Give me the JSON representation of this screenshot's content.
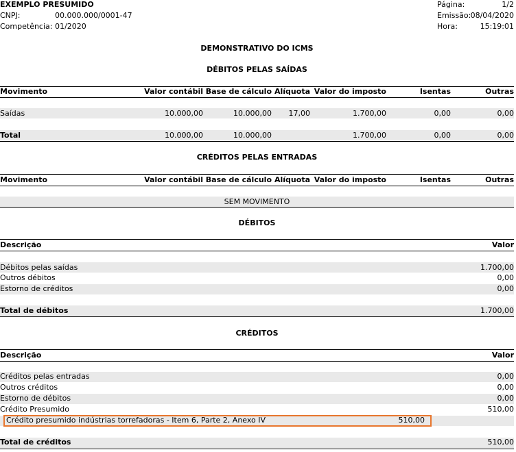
{
  "header": {
    "company": "EXEMPLO PRESUMIDO",
    "cnpj_label": "CNPJ:",
    "cnpj_value": "00.000.000/0001-47",
    "competencia_label": "Competência:",
    "competencia_value": "01/2020",
    "pagina_label": "Página:",
    "pagina_value": "1/2",
    "emissao_label": "Emissão:",
    "emissao_value": "08/04/2020",
    "hora_label": "Hora:",
    "hora_value": "15:19:01"
  },
  "report_title": "DEMONSTRATIVO DO ICMS",
  "debitos_saidas": {
    "title": "DÉBITOS PELAS SAÍDAS",
    "columns": [
      "Movimento",
      "Valor contábil",
      "Base de cálculo",
      "Alíquota",
      "Valor do imposto",
      "Isentas",
      "Outras"
    ],
    "row": [
      "Saídas",
      "10.000,00",
      "10.000,00",
      "17,00",
      "1.700,00",
      "0,00",
      "0,00"
    ],
    "total": [
      "Total",
      "10.000,00",
      "10.000,00",
      "",
      "1.700,00",
      "0,00",
      "0,00"
    ]
  },
  "creditos_entradas": {
    "title": "CRÉDITOS PELAS ENTRADAS",
    "columns": [
      "Movimento",
      "Valor contábil",
      "Base de cálculo",
      "Alíquota",
      "Valor do imposto",
      "Isentas",
      "Outras"
    ],
    "empty": "SEM MOVIMENTO"
  },
  "debitos": {
    "title": "DÉBITOS",
    "col_desc": "Descrição",
    "col_valor": "Valor",
    "rows": [
      {
        "desc": "Débitos pelas saídas",
        "valor": "1.700,00"
      },
      {
        "desc": "Outros débitos",
        "valor": "0,00"
      },
      {
        "desc": "Estorno de créditos",
        "valor": "0,00"
      }
    ],
    "total_label": "Total de débitos",
    "total_value": "1.700,00"
  },
  "creditos": {
    "title": "CRÉDITOS",
    "col_desc": "Descrição",
    "col_valor": "Valor",
    "rows": [
      {
        "desc": "Créditos pelas entradas",
        "valor": "0,00"
      },
      {
        "desc": "Outros créditos",
        "valor": "0,00"
      },
      {
        "desc": "Estorno de débitos",
        "valor": "0,00"
      },
      {
        "desc": "Crédito Presumido",
        "valor": "510,00"
      }
    ],
    "detail_desc": "Crédito presumido indústrias torrefadoras - Item 6, Parte 2, Anexo IV",
    "detail_value": "510,00",
    "total_label": "Total de créditos",
    "total_value": "510,00"
  },
  "colors": {
    "band": "#e9e9e9",
    "highlight_border": "#e8762d"
  }
}
